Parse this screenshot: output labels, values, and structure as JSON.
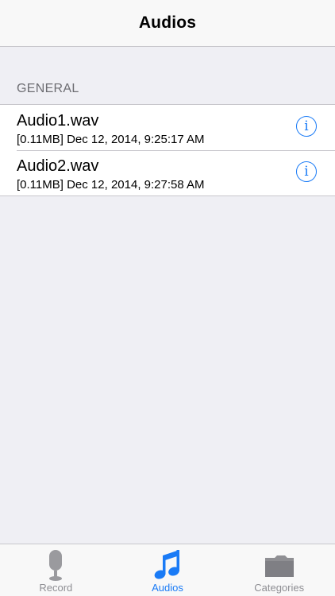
{
  "header": {
    "title": "Audios"
  },
  "section": {
    "title": "GENERAL"
  },
  "audios": [
    {
      "name": "Audio1.wav",
      "details": "[0.11MB] Dec 12, 2014, 9:25:17 AM"
    },
    {
      "name": "Audio2.wav",
      "details": "[0.11MB] Dec 12, 2014, 9:27:58 AM"
    }
  ],
  "info_icon": "info-circle-icon",
  "tabs": [
    {
      "label": "Record",
      "icon": "microphone-icon",
      "active": false
    },
    {
      "label": "Audios",
      "icon": "music-note-icon",
      "active": true
    },
    {
      "label": "Categories",
      "icon": "folder-icon",
      "active": false
    }
  ],
  "colors": {
    "accent": "#1a7bf6",
    "inactive": "#8e8e93",
    "background": "#efeff4",
    "separator": "#c8c7cc"
  }
}
